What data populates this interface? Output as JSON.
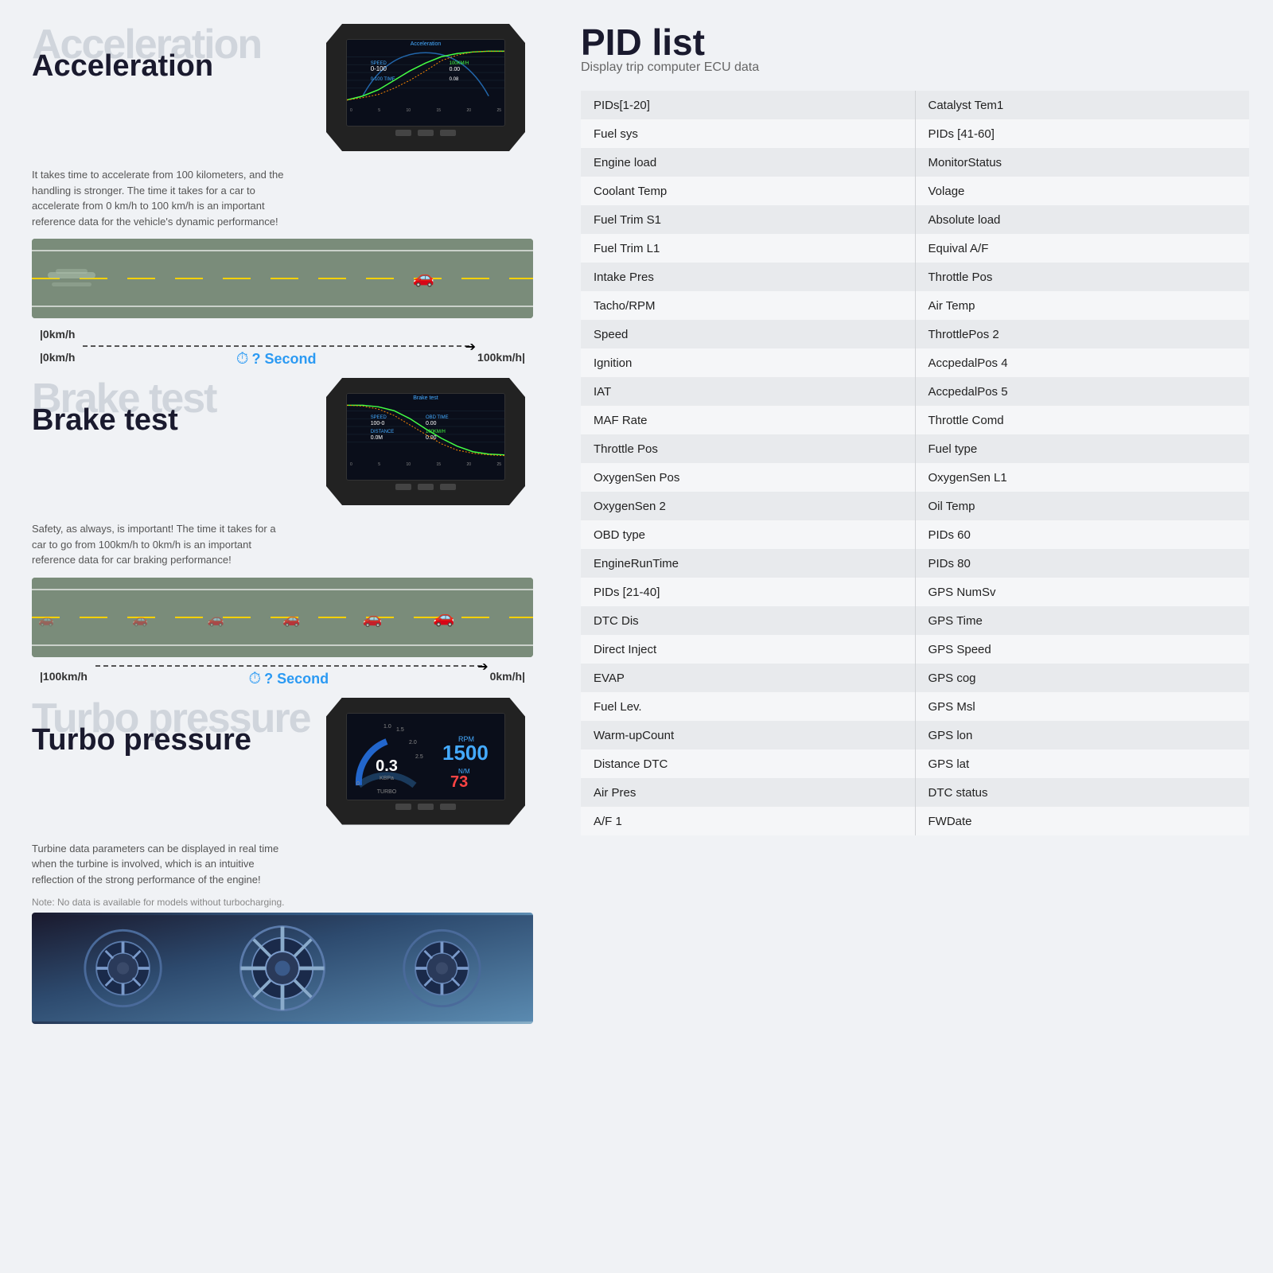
{
  "leftPanel": {
    "acceleration": {
      "watermark": "Acceleration",
      "title": "Acceleration",
      "desc": "It takes time to accelerate from 100 kilometers, and the handling is stronger. The time it takes for a car to accelerate from 0 km/h to 100 km/h is an important reference data for the vehicle's dynamic performance!",
      "screenTitle": "Acceleration",
      "speedLabels": {
        "start": "|0km/h",
        "end": "100km/h|",
        "time": "? Second"
      }
    },
    "brakeTest": {
      "watermark": "Brake test",
      "title": "Brake test",
      "desc": "Safety, as always, is important! The time it takes for a car to go from 100km/h to 0km/h is an important reference data for car braking performance!",
      "screenTitle": "Brake test",
      "speedLabels": {
        "start": "|100km/h",
        "end": "0km/h|",
        "time": "? Second"
      }
    },
    "turboPressure": {
      "watermark": "Turbo pressure",
      "title": "Turbo pressure",
      "desc": "Turbine data parameters can be displayed in real time when the turbine is involved, which is an intuitive reflection of the strong performance of the engine!",
      "note": "Note: No data is available for models without turbocharging.",
      "gaugeValue": "0.3",
      "rpmValue": "1500",
      "nmValue": "73"
    }
  },
  "rightPanel": {
    "title": "PID list",
    "subtitle": "Display trip computer ECU data",
    "rows": [
      {
        "col1": "PIDs[1-20]",
        "col2": "Catalyst Tem1"
      },
      {
        "col1": "Fuel sys",
        "col2": "PIDs [41-60]"
      },
      {
        "col1": "Engine load",
        "col2": "MonitorStatus"
      },
      {
        "col1": "Coolant Temp",
        "col2": "Volage"
      },
      {
        "col1": "Fuel Trim S1",
        "col2": "Absolute load"
      },
      {
        "col1": "Fuel Trim L1",
        "col2": "Equival A/F"
      },
      {
        "col1": "Intake Pres",
        "col2": "Throttle Pos"
      },
      {
        "col1": "Tacho/RPM",
        "col2": "Air Temp"
      },
      {
        "col1": "Speed",
        "col2": "ThrottlePos 2"
      },
      {
        "col1": "Ignition",
        "col2": "AccpedalPos 4"
      },
      {
        "col1": "IAT",
        "col2": "AccpedalPos 5"
      },
      {
        "col1": "MAF Rate",
        "col2": "Throttle Comd"
      },
      {
        "col1": "Throttle Pos",
        "col2": "Fuel type"
      },
      {
        "col1": "OxygenSen Pos",
        "col2": "OxygenSen L1"
      },
      {
        "col1": "OxygenSen 2",
        "col2": "Oil Temp"
      },
      {
        "col1": "OBD type",
        "col2": "PIDs 60"
      },
      {
        "col1": "EngineRunTime",
        "col2": "PIDs  80"
      },
      {
        "col1": "PIDs [21-40]",
        "col2": "GPS NumSv"
      },
      {
        "col1": "DTC Dis",
        "col2": "GPS Time"
      },
      {
        "col1": "Direct Inject",
        "col2": "GPS Speed"
      },
      {
        "col1": "EVAP",
        "col2": "GPS cog"
      },
      {
        "col1": "Fuel Lev.",
        "col2": "GPS Msl"
      },
      {
        "col1": "Warm-upCount",
        "col2": "GPS lon"
      },
      {
        "col1": "Distance DTC",
        "col2": "GPS lat"
      },
      {
        "col1": "Air Pres",
        "col2": "DTC status"
      },
      {
        "col1": "A/F 1",
        "col2": "FWDate"
      }
    ]
  }
}
